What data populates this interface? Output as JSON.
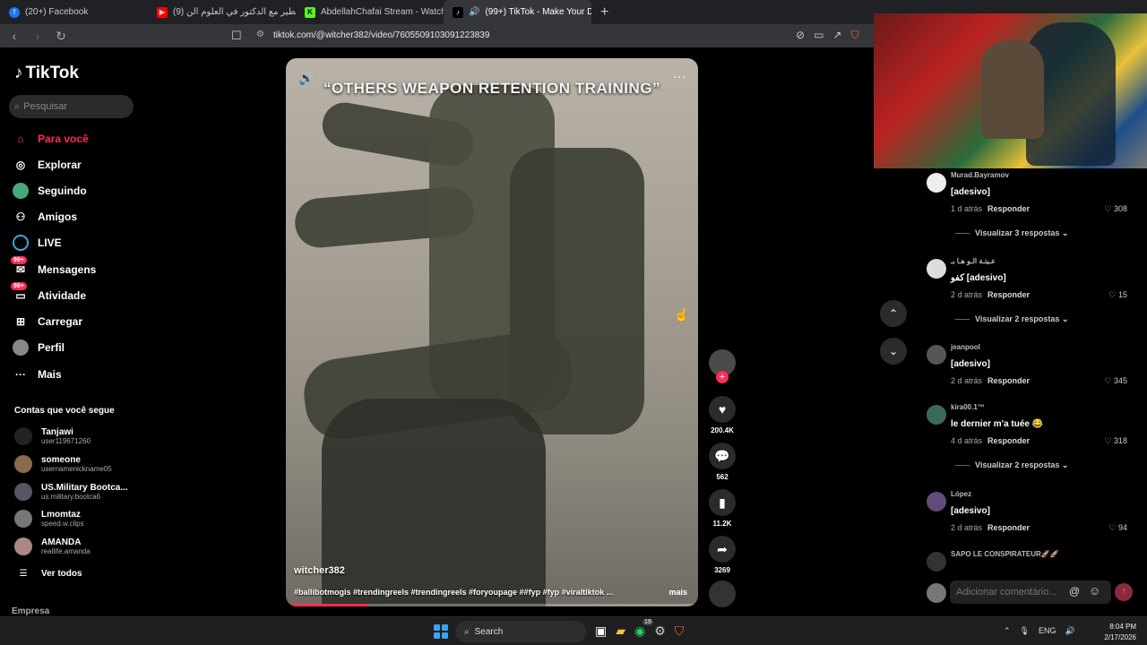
{
  "browser": {
    "tabs": [
      {
        "label": "(20+) Facebook",
        "icon": "facebook-icon",
        "active": false
      },
      {
        "label": "(9) ليف خطير مع الدكتور في العلوم الن...",
        "icon": "youtube-icon",
        "active": false
      },
      {
        "label": "AbdellahChafai Stream - Watch Live ...",
        "icon": "kick-icon",
        "active": false
      },
      {
        "label": "(99+) TikTok - Make Your Day",
        "icon": "tiktok-icon",
        "active": true
      }
    ],
    "url": "tiktok.com/@witcher382/video/7605509103091223839"
  },
  "sidebar": {
    "logo": "TikTok",
    "search_placeholder": "Pesquisar",
    "menu": [
      {
        "label": "Para você",
        "icon": "home-icon",
        "active": true
      },
      {
        "label": "Explorar",
        "icon": "compass-icon"
      },
      {
        "label": "Seguindo",
        "icon": "following-icon"
      },
      {
        "label": "Amigos",
        "icon": "friends-icon"
      },
      {
        "label": "LIVE",
        "icon": "live-icon"
      },
      {
        "label": "Mensagens",
        "icon": "messages-icon",
        "badge": "99+"
      },
      {
        "label": "Atividade",
        "icon": "activity-icon",
        "badge": "99+"
      },
      {
        "label": "Carregar",
        "icon": "upload-icon"
      },
      {
        "label": "Perfil",
        "icon": "profile-icon"
      },
      {
        "label": "Mais",
        "icon": "more-icon"
      }
    ],
    "following_title": "Contas que você segue",
    "following": [
      {
        "name": "Tanjawi",
        "user": "user119671260"
      },
      {
        "name": "someone",
        "user": "usernamenickname05"
      },
      {
        "name": "US.Military Bootca...",
        "user": "us.military.bootca6"
      },
      {
        "name": "Lmomtaz",
        "user": "speed.w.clips"
      },
      {
        "name": "AMANDA",
        "user": "reallife.amanda"
      }
    ],
    "see_all": "Ver todos",
    "empresa": "Empresa"
  },
  "video": {
    "overlay_title": "“OTHERS WEAPON RETENTION TRAINING”",
    "author": "witcher382",
    "tags": "#ballibotmogis #trendingreels #trendingreels #foryoupage ##fyp #fyp #viraltiktok ...",
    "more_label": "mais",
    "progress": 0.2
  },
  "actions": {
    "likes": "200.4K",
    "comments": "562",
    "saves": "11.2K",
    "shares": "3269"
  },
  "comments": [
    {
      "user": "Murad.Bayramov",
      "text": "[adesivo]",
      "time": "1 d atrás",
      "reply": "Responder",
      "likes": "308",
      "replies": "Visualizar 3 respostas"
    },
    {
      "user": "عـيتـة الـو هـا بـ",
      "text": "كفو [adesivo]",
      "time": "2 d atrás",
      "reply": "Responder",
      "likes": "15",
      "replies": "Visualizar 2 respostas"
    },
    {
      "user": "jeanpool",
      "text": "[adesivo]",
      "time": "2 d atrás",
      "reply": "Responder",
      "likes": "345",
      "replies": ""
    },
    {
      "user": "kira00.1™",
      "text": "le dernier m'a tuée 😂",
      "time": "4 d atrás",
      "reply": "Responder",
      "likes": "318",
      "replies": "Visualizar 2 respostas"
    },
    {
      "user": "López",
      "text": "[adesivo]",
      "time": "2 d atrás",
      "reply": "Responder",
      "likes": "94",
      "replies": ""
    },
    {
      "user": "SAPO LE CONSPIRATEUR🚀🚀",
      "text": "",
      "time": "",
      "reply": "",
      "likes": "",
      "replies": ""
    }
  ],
  "comment_input": {
    "placeholder": "Adicionar comentário..."
  },
  "taskbar": {
    "search": "Search",
    "lang": "ENG",
    "time": "8:04 PM",
    "date": "2/17/2026",
    "badge": "19"
  },
  "colors": {
    "accent": "#fe2c55",
    "bg": "#000000"
  }
}
